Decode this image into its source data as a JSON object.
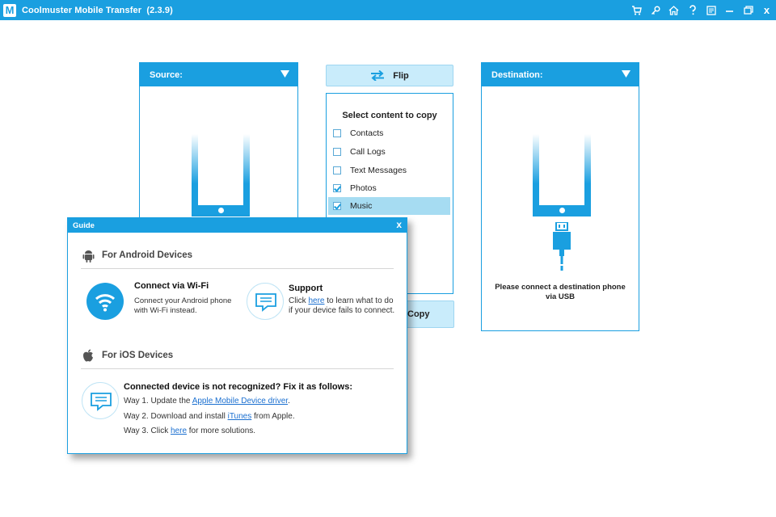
{
  "app": {
    "title": "Coolmuster Mobile Transfer",
    "version": "(2.3.9)",
    "logo": "M"
  },
  "toolbar_icons": [
    "cart-icon",
    "key-icon",
    "home-icon",
    "help-icon",
    "feedback-icon",
    "minimize-icon",
    "restore-icon",
    "close-icon"
  ],
  "toolbar_close": "x",
  "source": {
    "label": "Source:"
  },
  "destination": {
    "label": "Destination:",
    "message_line1": "Please connect a destination phone",
    "message_line2": "via USB"
  },
  "flip": {
    "label": "Flip"
  },
  "content": {
    "title": "Select content to copy",
    "items": [
      {
        "label": "Contacts",
        "checked": false
      },
      {
        "label": "Call Logs",
        "checked": false
      },
      {
        "label": "Text Messages",
        "checked": false
      },
      {
        "label": "Photos",
        "checked": true
      },
      {
        "label": "Music",
        "checked": true
      }
    ]
  },
  "copy": {
    "label": "Copy"
  },
  "guide": {
    "title": "Guide",
    "close": "x",
    "android": {
      "heading": "For Android Devices",
      "wifi_title": "Connect via Wi-Fi",
      "wifi_line1": "Connect your Android phone",
      "wifi_line2": "with Wi-Fi instead.",
      "support_title": "Support",
      "support_click": "Click",
      "support_link": "here",
      "support_rest1": "to learn what to do",
      "support_line2": "if your device fails to connect."
    },
    "ios": {
      "heading": "For iOS Devices",
      "fix_title": "Connected device is not recognized? Fix it as follows:",
      "way1_text": "Way 1. Update the",
      "way1_link": "Apple Mobile Device driver",
      "way1_end": ".",
      "way2_text": "Way 2. Download and install",
      "way2_link": "iTunes",
      "way2_end": "from Apple.",
      "way3_text": "Way 3. Click",
      "way3_link": "here",
      "way3_end": "for more solutions."
    }
  },
  "colors": {
    "accent": "#1a9fe0",
    "highlight": "#a6dcf2",
    "button_bg": "#c9ecfb",
    "link": "#1a6fd0"
  }
}
